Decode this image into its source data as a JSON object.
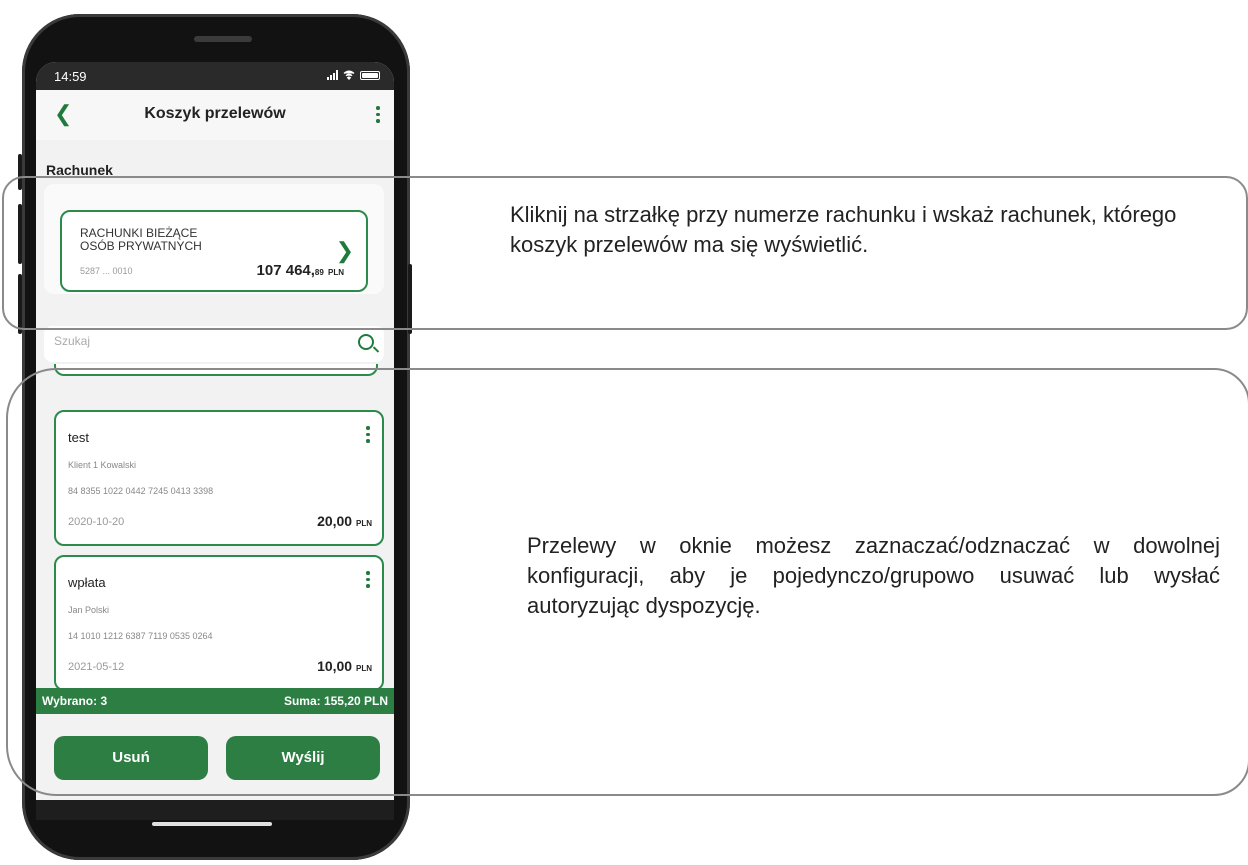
{
  "status_bar": {
    "time": "14:59"
  },
  "app_bar": {
    "title": "Koszyk przelewów"
  },
  "account_section": {
    "label": "Rachunek",
    "account_name": "RACHUNKI BIEŻĄCE\nOSÓB PRYWATNYCH",
    "account_number": "5287 ... 0010",
    "amount": "107 464,",
    "amount_decimals": "89",
    "currency": "PLN"
  },
  "search": {
    "placeholder": "Szukaj"
  },
  "transfers": [
    {
      "title": "test",
      "recipient": "Klient 1 Kowalski",
      "account": "84 8355 1022 0442 7245 0413 3398",
      "date": "2020-10-20",
      "amount": "20,00",
      "currency": "PLN"
    },
    {
      "title": "wpłata",
      "recipient": "Jan Polski",
      "account": "14 1010 1212 6387 7119 0535 0264",
      "date": "2021-05-12",
      "amount": "10,00",
      "currency": "PLN"
    }
  ],
  "summary": {
    "selected": "Wybrano: 3",
    "total": "Suma: 155,20 PLN"
  },
  "buttons": {
    "delete": "Usuń",
    "send": "Wyślij"
  },
  "callouts": {
    "account_hint": "Kliknij na strzałkę przy numerze rachunku i wskaż rachunek, którego koszyk przelewów ma się wyświetlić.",
    "transfers_hint": "Przelewy w oknie możesz zaznaczać/odznaczać w dowolnej konfiguracji, aby je pojedynczo/grupowo usuwać lub wysłać autoryzując dyspozycję."
  },
  "colors": {
    "accent": "#2c7e43",
    "frame": "#121212"
  }
}
